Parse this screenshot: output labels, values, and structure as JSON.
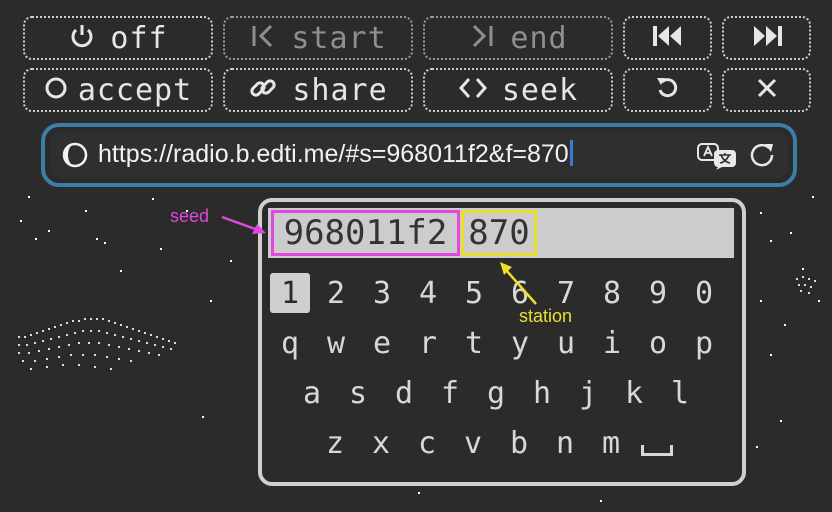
{
  "toolbar": {
    "row1": [
      {
        "name": "power-off-button",
        "icon": "power-icon",
        "glyph": "⏻",
        "label": "off",
        "enabled": true
      },
      {
        "name": "start-button",
        "icon": "skip-to-start-icon",
        "glyph": "|❮",
        "label": "start",
        "enabled": false
      },
      {
        "name": "end-button",
        "icon": "skip-to-end-icon",
        "glyph": "❯|",
        "label": "end",
        "enabled": false
      },
      {
        "name": "previous-button",
        "icon": "previous-track-icon",
        "glyph": "⏮",
        "label": "",
        "enabled": true
      },
      {
        "name": "next-button",
        "icon": "next-track-icon",
        "glyph": "⏭",
        "label": "",
        "enabled": true
      }
    ],
    "row2": [
      {
        "name": "accept-button",
        "icon": "circle-icon",
        "glyph": "O",
        "label": "accept",
        "enabled": true
      },
      {
        "name": "share-button",
        "icon": "link-icon",
        "glyph": "🔗",
        "label": "share",
        "enabled": true
      },
      {
        "name": "seek-button",
        "icon": "code-brackets-icon",
        "glyph": "<>",
        "label": "seek",
        "enabled": true
      },
      {
        "name": "undo-button",
        "icon": "undo-icon",
        "glyph": "↺",
        "label": "",
        "enabled": true
      },
      {
        "name": "close-button",
        "icon": "close-icon",
        "glyph": "✕",
        "label": "",
        "enabled": true
      }
    ]
  },
  "urlbar": {
    "url": "https://radio.b.edti.me/#s=968011f2&f=870",
    "icons": [
      "moon-icon",
      "translate-icon",
      "reload-icon"
    ]
  },
  "display": {
    "seed": "968011f2",
    "station": "870"
  },
  "annotations": {
    "seed_label": "seed",
    "station_label": "station",
    "seed_color": "#e048e0",
    "station_color": "#e8e02a"
  },
  "keyboard": {
    "selected_key": "1",
    "rows": [
      [
        "1",
        "2",
        "3",
        "4",
        "5",
        "6",
        "7",
        "8",
        "9",
        "0"
      ],
      [
        "q",
        "w",
        "e",
        "r",
        "t",
        "y",
        "u",
        "i",
        "o",
        "p"
      ],
      [
        "a",
        "s",
        "d",
        "f",
        "g",
        "h",
        "j",
        "k",
        "l"
      ],
      [
        "z",
        "x",
        "c",
        "v",
        "b",
        "n",
        "m",
        "space"
      ]
    ]
  },
  "colors": {
    "background": "#2b2b2b",
    "url_focus_ring": "#3c7ea8",
    "caret": "#3a7bd5",
    "panel_border": "#cfcfcf"
  }
}
